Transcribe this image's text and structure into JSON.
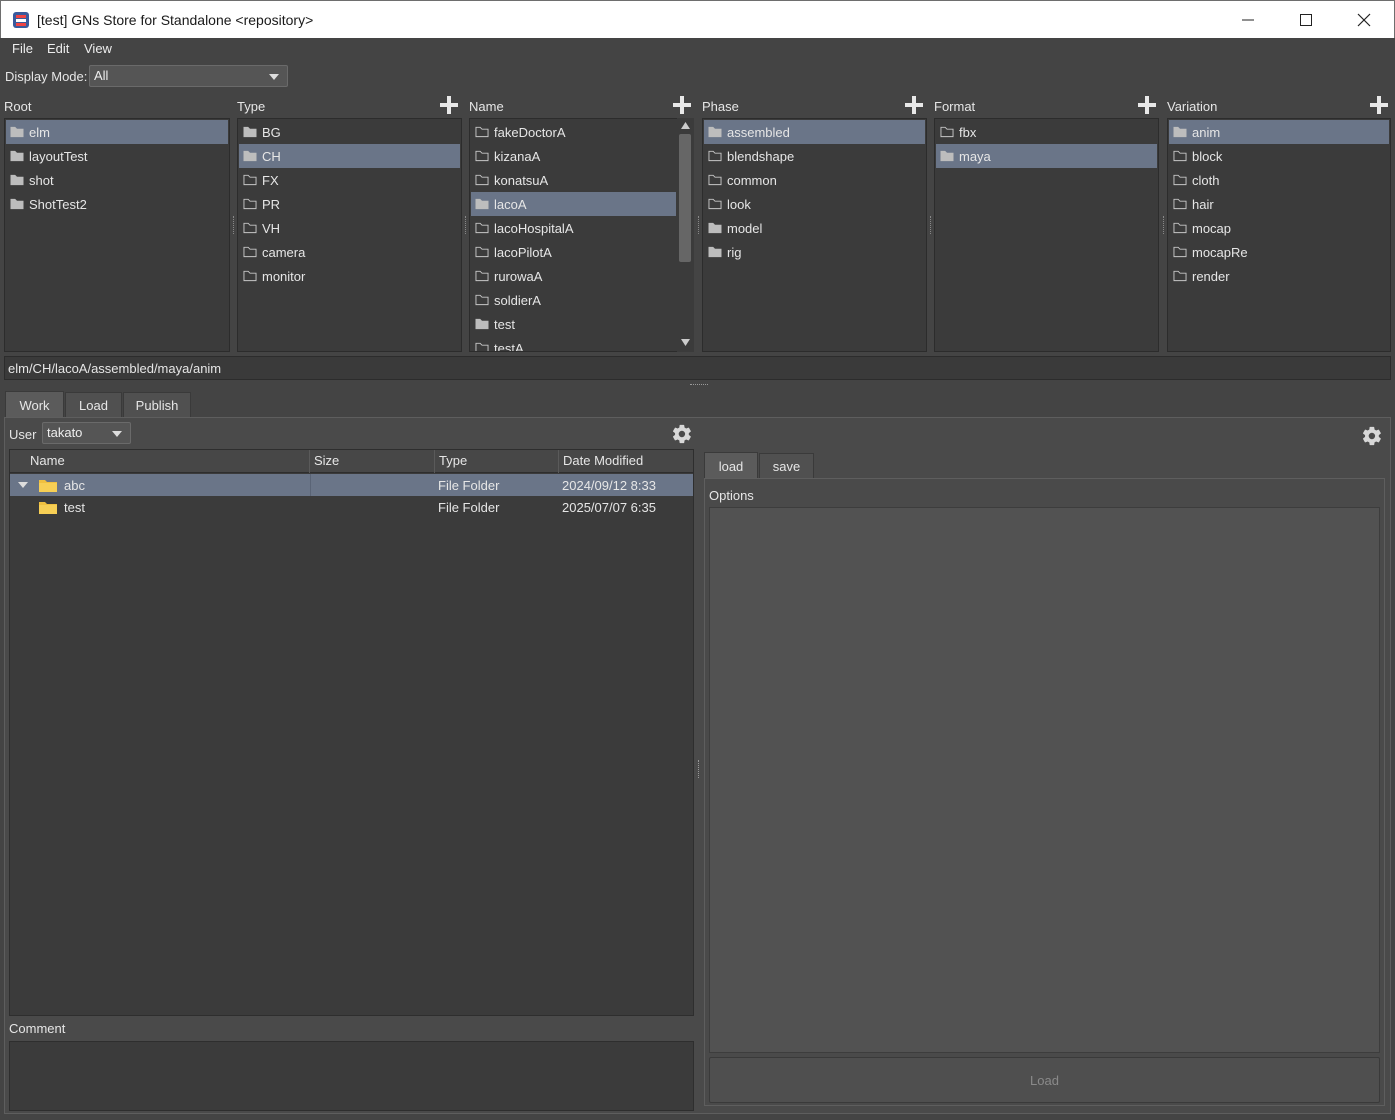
{
  "window": {
    "title": "[test] GNs Store for Standalone <repository>",
    "controls": [
      "minimize",
      "maximize",
      "close"
    ]
  },
  "menu": {
    "items": [
      "File",
      "Edit",
      "View"
    ]
  },
  "display_mode": {
    "label": "Display Mode:",
    "value": "All"
  },
  "columns": [
    {
      "header": "Root",
      "has_add": false,
      "items": [
        {
          "label": "elm",
          "selected": true,
          "filled": true
        },
        {
          "label": "layoutTest",
          "filled": true
        },
        {
          "label": "shot",
          "filled": true
        },
        {
          "label": "ShotTest2",
          "filled": true
        }
      ]
    },
    {
      "header": "Type",
      "has_add": true,
      "items": [
        {
          "label": "BG",
          "filled": true
        },
        {
          "label": "CH",
          "selected": true,
          "filled": true
        },
        {
          "label": "FX"
        },
        {
          "label": "PR"
        },
        {
          "label": "VH"
        },
        {
          "label": "camera"
        },
        {
          "label": "monitor"
        }
      ]
    },
    {
      "header": "Name",
      "has_add": true,
      "items": [
        {
          "label": "fakeDoctorA"
        },
        {
          "label": "kizanaA"
        },
        {
          "label": "konatsuA"
        },
        {
          "label": "lacoA",
          "selected": true,
          "filled": true
        },
        {
          "label": "lacoHospitalA"
        },
        {
          "label": "lacoPilotA"
        },
        {
          "label": "rurowaA"
        },
        {
          "label": "soldierA"
        },
        {
          "label": "test",
          "filled": true
        },
        {
          "label": "testA"
        }
      ]
    },
    {
      "header": "Phase",
      "has_add": true,
      "items": [
        {
          "label": "assembled",
          "selected": true,
          "filled": true
        },
        {
          "label": "blendshape"
        },
        {
          "label": "common"
        },
        {
          "label": "look"
        },
        {
          "label": "model",
          "filled": true
        },
        {
          "label": "rig",
          "filled": true
        }
      ]
    },
    {
      "header": "Format",
      "has_add": true,
      "items": [
        {
          "label": "fbx"
        },
        {
          "label": "maya",
          "selected": true,
          "filled": true
        }
      ]
    },
    {
      "header": "Variation",
      "has_add": true,
      "items": [
        {
          "label": "anim",
          "selected": true,
          "filled": true
        },
        {
          "label": "block"
        },
        {
          "label": "cloth"
        },
        {
          "label": "hair"
        },
        {
          "label": "mocap"
        },
        {
          "label": "mocapRe"
        },
        {
          "label": "render"
        }
      ]
    }
  ],
  "path": "elm/CH/lacoA/assembled/maya/anim",
  "main_tabs": [
    "Work",
    "Load",
    "Publish"
  ],
  "user": {
    "label": "User",
    "value": "takato"
  },
  "file_table": {
    "headers": [
      "Name",
      "Size",
      "Type",
      "Date Modified"
    ],
    "rows": [
      {
        "name": "abc",
        "size": "",
        "type": "File Folder",
        "date": "2024/09/12 8:33",
        "selected": true,
        "expanded": true
      },
      {
        "name": "test",
        "size": "",
        "type": "File Folder",
        "date": "2025/07/07 6:35"
      }
    ]
  },
  "comment_label": "Comment",
  "right_tabs": [
    "load",
    "save"
  ],
  "options_label": "Options",
  "load_button": "Load",
  "colors": {
    "selection": "#6a7588",
    "background": "#444444",
    "list_bg": "#3b3b3b"
  }
}
